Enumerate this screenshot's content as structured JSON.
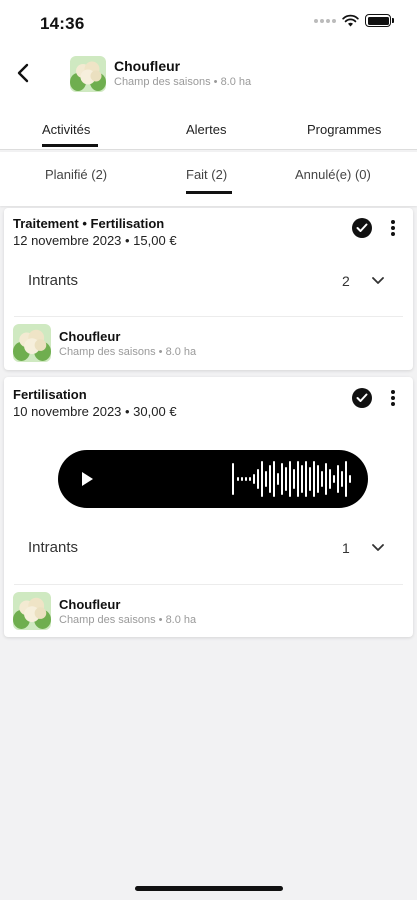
{
  "status_bar": {
    "time": "14:36"
  },
  "header": {
    "title": "Choufleur",
    "subtitle": "Champ des saisons • 8.0 ha",
    "thumbnail_icon": "cauliflower-icon"
  },
  "main_tabs": [
    {
      "label": "Activités",
      "active": true
    },
    {
      "label": "Alertes",
      "active": false
    },
    {
      "label": "Programmes",
      "active": false
    }
  ],
  "sub_tabs": [
    {
      "label": "Planifié (2)",
      "active": false
    },
    {
      "label": "Fait (2)",
      "active": true
    },
    {
      "label": "Annulé(e) (0)",
      "active": false
    }
  ],
  "activities": [
    {
      "title": "Traitement  • Fertilisation",
      "date_cost": "12 novembre 2023 • 15,00 €",
      "status": "done",
      "intrants_label": "Intrants",
      "intrants_count": "2",
      "crop": {
        "title": "Choufleur",
        "subtitle": "Champ des saisons • 8.0 ha",
        "icon": "cauliflower-icon"
      }
    },
    {
      "title": "Fertilisation",
      "date_cost": "10 novembre 2023 • 30,00 €",
      "status": "done",
      "has_audio": true,
      "intrants_label": "Intrants",
      "intrants_count": "1",
      "crop": {
        "title": "Choufleur",
        "subtitle": "Champ des saisons • 8.0 ha",
        "icon": "cauliflower-icon"
      }
    }
  ],
  "colors": {
    "accent": "#111111",
    "thumbnail_bg": "#cfe9c1",
    "background": "#f2f2f3",
    "secondary_text": "#9a9a9a"
  }
}
